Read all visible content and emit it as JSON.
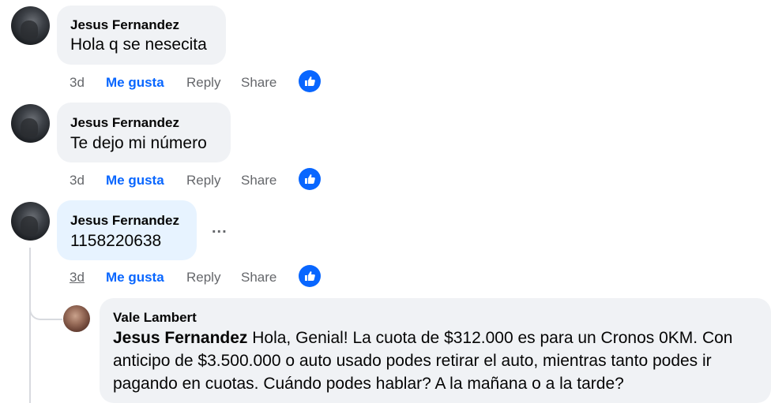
{
  "comments": [
    {
      "author": "Jesus Fernandez",
      "text": "Hola q se nesecita",
      "time": "3d",
      "like": "Me gusta",
      "reply": "Reply",
      "share": "Share"
    },
    {
      "author": "Jesus Fernandez",
      "text": "Te dejo mi número",
      "time": "3d",
      "like": "Me gusta",
      "reply": "Reply",
      "share": "Share"
    },
    {
      "author": "Jesus Fernandez",
      "text": "1158220638",
      "time": "3d",
      "like": "Me gusta",
      "reply": "Reply",
      "share": "Share",
      "more": "..."
    }
  ],
  "reply": {
    "author": "Vale Lambert",
    "mention": "Jesus Fernandez",
    "text": " Hola, Genial! La cuota de $312.000 es para un Cronos 0KM. Con anticipo de $3.500.000 o auto usado podes retirar el auto, mientras tanto podes ir pagando en cuotas. Cuándo podes hablar? A la mañana o a la tarde?"
  },
  "colors": {
    "accent": "#0866ff",
    "bubble": "#f0f2f5",
    "bubble_highlight": "#e7f3ff",
    "secondary_text": "#65676b"
  },
  "icons": [
    "like-reaction-icon",
    "more-options-icon"
  ]
}
